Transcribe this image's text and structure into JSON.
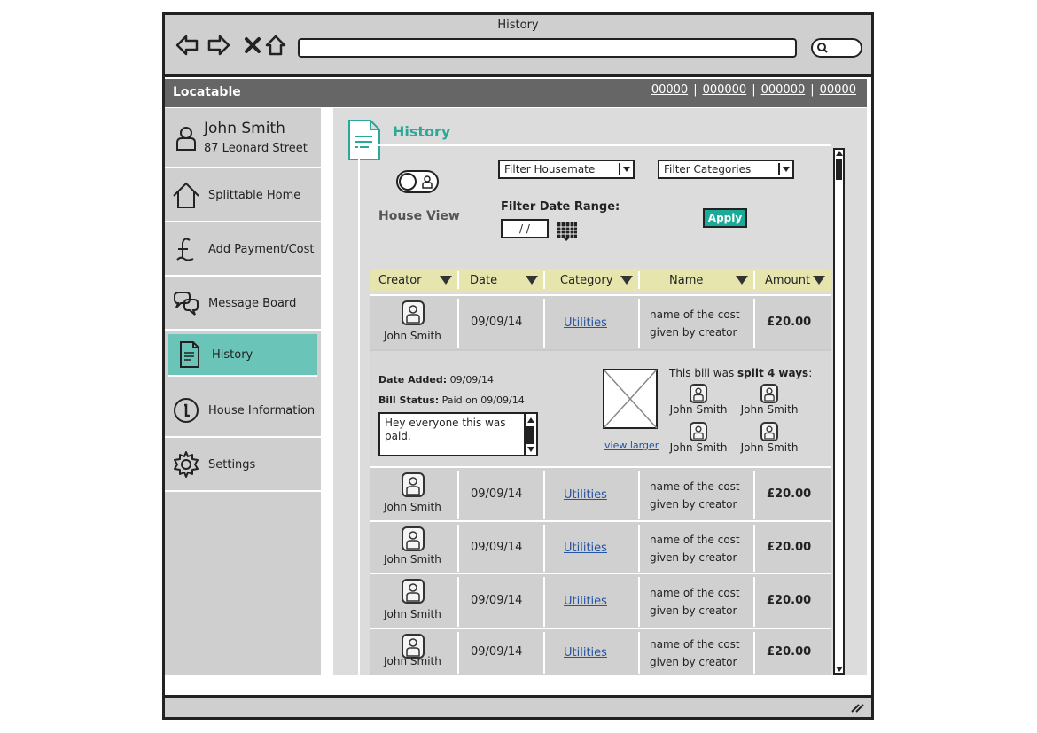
{
  "window": {
    "title": "History"
  },
  "app": {
    "brand": "Locatable",
    "top_links": [
      "00000",
      "000000",
      "000000",
      "00000"
    ]
  },
  "user": {
    "name": "John Smith",
    "address": "87 Leonard Street"
  },
  "sidebar": {
    "items": [
      {
        "label": "Splittable Home",
        "icon": "home-icon"
      },
      {
        "label": "Add Payment/Cost",
        "icon": "pound-icon"
      },
      {
        "label": "Message Board",
        "icon": "chat-icon"
      },
      {
        "label": "History",
        "icon": "document-icon",
        "active": true
      },
      {
        "label": "House Information",
        "icon": "info-icon"
      },
      {
        "label": "Settings",
        "icon": "gear-icon"
      }
    ]
  },
  "main": {
    "title": "History",
    "house_view_label": "House View",
    "filter_housemate": "Filter Housemate",
    "filter_categories": "Filter Categories",
    "filter_date_label": "Filter Date Range:",
    "date_value": "/ /",
    "apply_label": "Apply"
  },
  "table": {
    "headers": [
      "Creator",
      "Date",
      "Category",
      "Name",
      "Amount"
    ],
    "rows": [
      {
        "creator": "John Smith",
        "date": "09/09/14",
        "category": "Utilities",
        "name1": "name of the cost",
        "name2": "given by creator",
        "amount": "£20.00"
      },
      {
        "creator": "John Smith",
        "date": "09/09/14",
        "category": "Utilities",
        "name1": "name of the cost",
        "name2": "given by creator",
        "amount": "£20.00"
      },
      {
        "creator": "John Smith",
        "date": "09/09/14",
        "category": "Utilities",
        "name1": "name of the cost",
        "name2": "given by creator",
        "amount": "£20.00"
      },
      {
        "creator": "John Smith",
        "date": "09/09/14",
        "category": "Utilities",
        "name1": "name of the cost",
        "name2": "given by creator",
        "amount": "£20.00"
      },
      {
        "creator": "John Smith",
        "date": "09/09/14",
        "category": "Utilities",
        "name1": "name of the cost",
        "name2": "given by creator",
        "amount": "£20.00"
      }
    ]
  },
  "detail": {
    "date_added_label": "Date Added:",
    "date_added": "09/09/14",
    "bill_status_label": "Bill Status:",
    "bill_status": "Paid on 09/09/14",
    "comment": "Hey everyone this was paid.",
    "view_larger": "view larger",
    "split_prefix": "This bill was ",
    "split_bold": "split 4 ways",
    "split_suffix": ":",
    "split_people": [
      "John Smith",
      "John Smith",
      "John Smith",
      "John Smith"
    ]
  }
}
